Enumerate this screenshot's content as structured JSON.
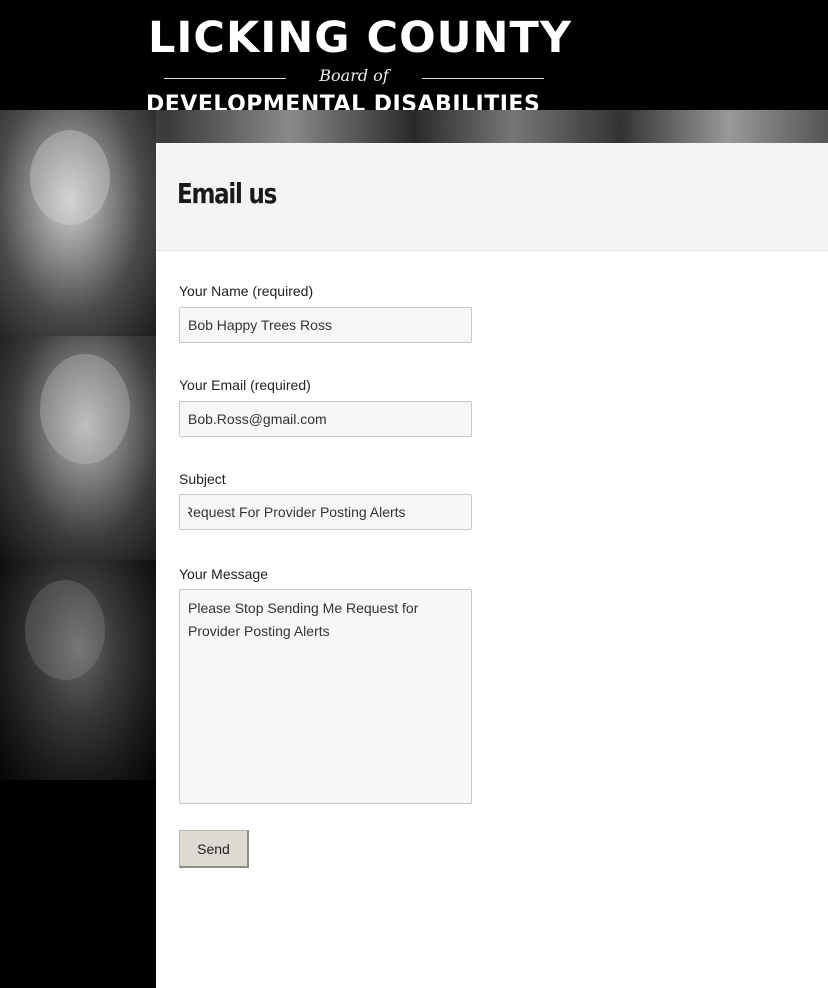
{
  "header": {
    "logo_line1": "LICKING COUNTY",
    "logo_line2": "Board of",
    "logo_line3": "DEVELOPMENTAL DISABILITIES"
  },
  "page": {
    "title": "Email us"
  },
  "form": {
    "name_label": "Your Name (required)",
    "name_value": "Bob Happy Trees Ross",
    "email_label": "Your Email (required)",
    "email_value": "Bob.Ross@gmail.com",
    "subject_label": "Subject",
    "subject_value": "Request For Provider Posting Alerts",
    "message_label": "Your Message",
    "message_value": "Please Stop Sending Me Request for Provider Posting Alerts",
    "send_label": "Send"
  },
  "colors": {
    "background": "#000000",
    "content_background": "#ffffff",
    "title_bar": "#f4f4f4",
    "input_background": "#f7f7f7",
    "button_background": "#dedad3"
  }
}
